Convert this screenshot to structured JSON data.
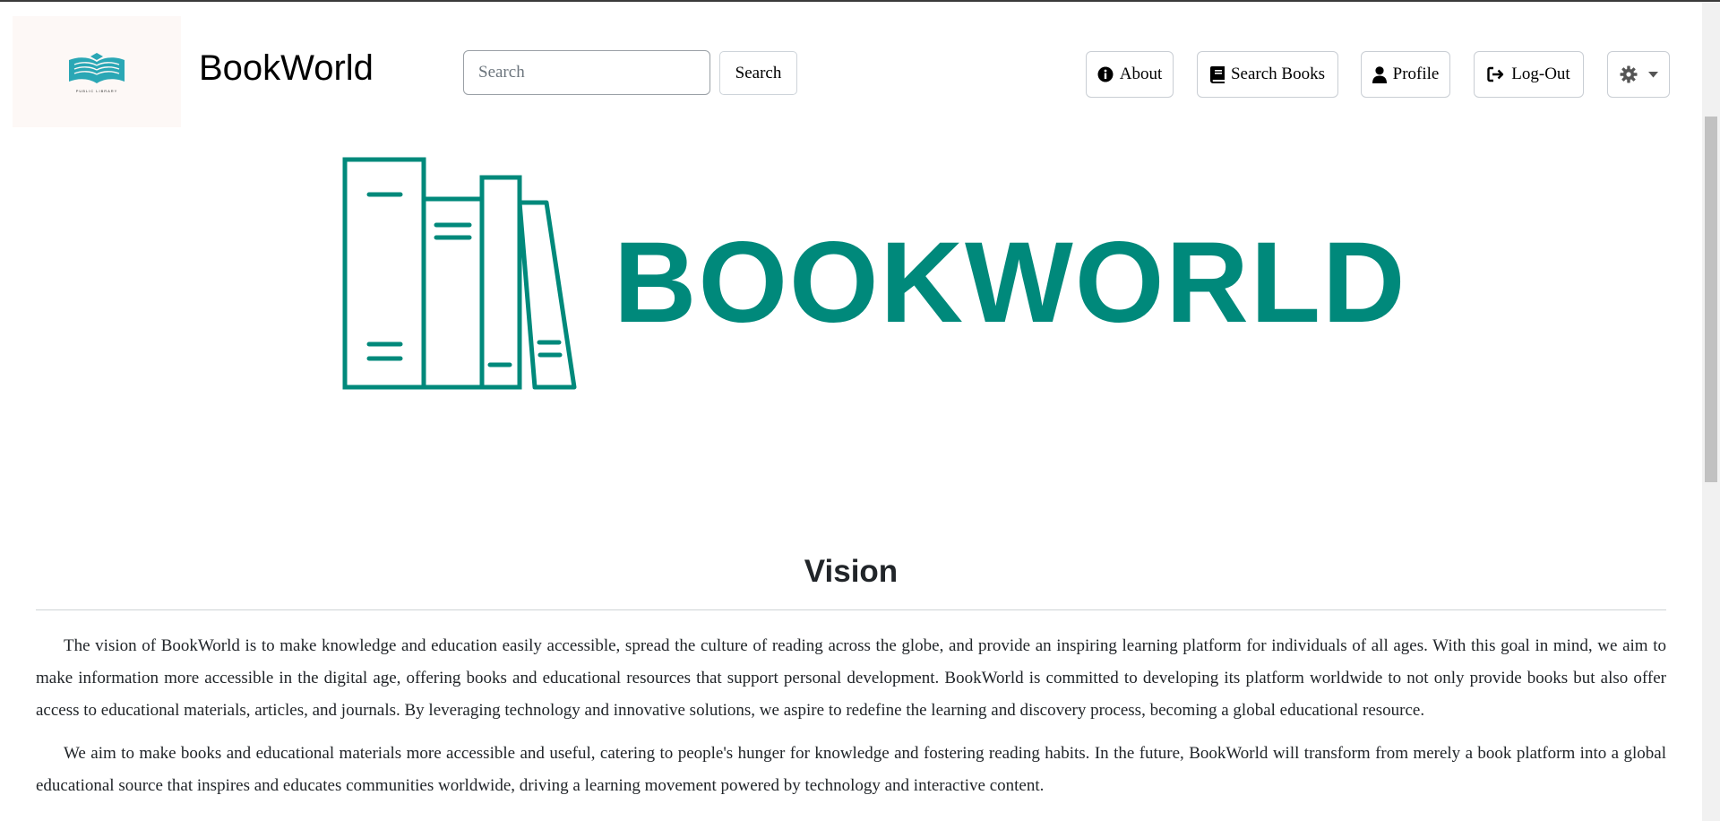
{
  "header": {
    "logo_caption": "PUBLIC LIBRARY",
    "brand": "BookWorld",
    "search": {
      "placeholder": "Search",
      "value": "",
      "button_label": "Search"
    },
    "nav": {
      "about": "About",
      "search_books": "Search Books",
      "profile": "Profile",
      "logout": "Log-Out"
    },
    "icons": [
      "info-circle-icon",
      "book-icon",
      "user-icon",
      "sign-out-icon",
      "gear-icon",
      "caret-down-icon"
    ]
  },
  "hero": {
    "wordmark": "BOOKWORLD",
    "accent_color": "#00897b"
  },
  "vision": {
    "title": "Vision",
    "paragraphs": [
      "The vision of BookWorld is to make knowledge and education easily accessible, spread the culture of reading across the globe, and provide an inspiring learning platform for individuals of all ages. With this goal in mind, we aim to make information more accessible in the digital age, offering books and educational resources that support personal development. BookWorld is committed to developing its platform worldwide to not only provide books but also offer access to educational materials, articles, and journals. By leveraging technology and innovative solutions, we aspire to redefine the learning and discovery process, becoming a global educational resource.",
      "We aim to make books and educational materials more accessible and useful, catering to people's hunger for knowledge and fostering reading habits. In the future, BookWorld will transform from merely a book platform into a global educational source that inspires and educates communities worldwide, driving a learning movement powered by technology and interactive content."
    ]
  }
}
